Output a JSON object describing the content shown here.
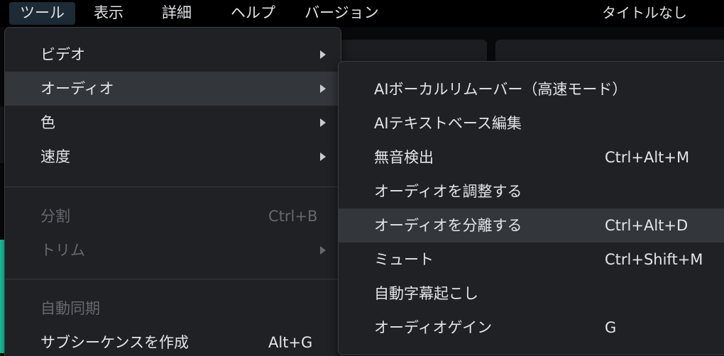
{
  "menubar": {
    "items": [
      {
        "label": "ツール"
      },
      {
        "label": "表示"
      },
      {
        "label": "詳細"
      },
      {
        "label": "ヘルプ"
      },
      {
        "label": "バージョン"
      }
    ],
    "window_title": "タイトルなし"
  },
  "tools_menu": {
    "items": [
      {
        "label": "ビデオ",
        "has_submenu": true
      },
      {
        "label": "オーディオ",
        "has_submenu": true,
        "highlighted": true
      },
      {
        "label": "色",
        "has_submenu": true
      },
      {
        "label": "速度",
        "has_submenu": true
      },
      {
        "label": "分割",
        "shortcut": "Ctrl+B",
        "disabled": true
      },
      {
        "label": "トリム",
        "has_submenu": true,
        "disabled": true
      },
      {
        "label": "自動同期",
        "disabled": true
      },
      {
        "label": "サブシーケンスを作成",
        "shortcut": "Alt+G"
      }
    ]
  },
  "audio_submenu": {
    "items": [
      {
        "label": "AIボーカルリムーバー（高速モード）"
      },
      {
        "label": "AIテキストベース編集"
      },
      {
        "label": "無音検出",
        "shortcut": "Ctrl+Alt+M"
      },
      {
        "label": "オーディオを調整する"
      },
      {
        "label": "オーディオを分離する",
        "shortcut": "Ctrl+Alt+D",
        "highlighted": true
      },
      {
        "label": "ミュート",
        "shortcut": "Ctrl+Shift+M"
      },
      {
        "label": "自動字幕起こし"
      },
      {
        "label": "オーディオゲイン",
        "shortcut": "G"
      }
    ]
  }
}
